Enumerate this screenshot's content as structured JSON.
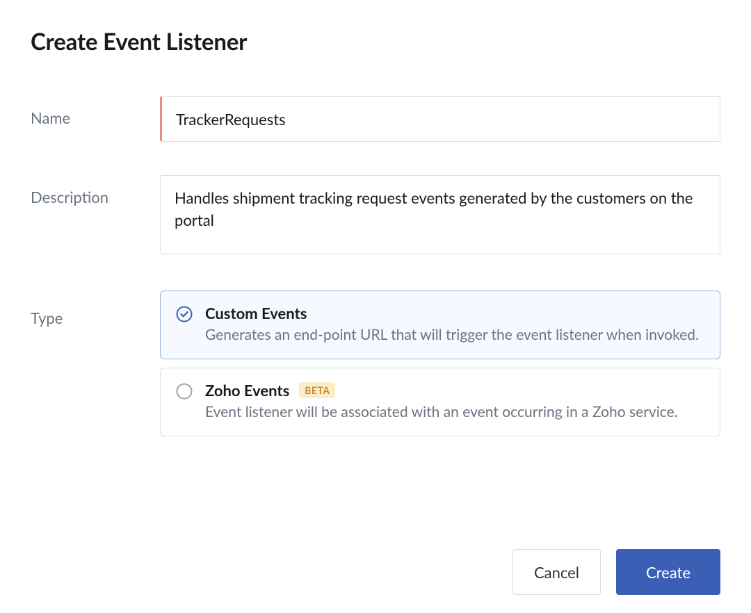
{
  "header": {
    "title": "Create Event Listener"
  },
  "form": {
    "name_label": "Name",
    "name_value": "TrackerRequests",
    "description_label": "Description",
    "description_value": "Handles shipment tracking request events generated by the customers on the portal",
    "type_label": "Type"
  },
  "type_options": [
    {
      "title": "Custom Events",
      "description": "Generates an end-point URL that will trigger the event listener when invoked.",
      "selected": true,
      "badge": null
    },
    {
      "title": "Zoho Events",
      "description": "Event listener will be associated with an event occurring in a Zoho service.",
      "selected": false,
      "badge": "BETA"
    }
  ],
  "footer": {
    "cancel_label": "Cancel",
    "create_label": "Create"
  },
  "colors": {
    "accent": "#3c5fb6",
    "required_indicator": "#e88a86",
    "selected_border": "#9cb7e0",
    "selected_bg": "#f6f9ff",
    "badge_bg": "#fbedc9",
    "badge_text": "#c77f12"
  }
}
